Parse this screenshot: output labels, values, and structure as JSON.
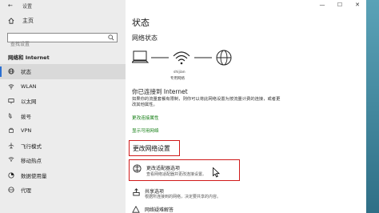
{
  "window": {
    "title": "设置",
    "controls": {
      "minimize": "—",
      "maximize": "☐",
      "close": "✕"
    }
  },
  "sidebar": {
    "back": "←",
    "home": "主页",
    "search_placeholder": "查找设置",
    "section": "网络和 Internet",
    "items": [
      {
        "label": "状态",
        "icon": "globe-icon"
      },
      {
        "label": "WLAN",
        "icon": "wifi-icon"
      },
      {
        "label": "以太网",
        "icon": "ethernet-icon"
      },
      {
        "label": "拨号",
        "icon": "dialup-icon"
      },
      {
        "label": "VPN",
        "icon": "vpn-icon"
      },
      {
        "label": "飞行模式",
        "icon": "airplane-icon"
      },
      {
        "label": "移动热点",
        "icon": "hotspot-icon"
      },
      {
        "label": "数据使用量",
        "icon": "data-usage-icon"
      },
      {
        "label": "代理",
        "icon": "globe-icon"
      }
    ]
  },
  "main": {
    "title": "状态",
    "network_status": "网络状态",
    "diagram": {
      "network_name": "shijian",
      "network_type": "专用网络"
    },
    "connected_heading": "你已连接到 Internet",
    "connected_desc": "如果你的流量套餐有限制，则你可以将此网络设置为按流量计费的连接，或者更改其他属性。",
    "change_properties": "更改连接属性",
    "show_networks": "显示可用网络",
    "change_settings": "更改网络设置",
    "adapter": {
      "title": "更改适配器选项",
      "desc": "查看网络适配器并更改连接设置。"
    },
    "sharing": {
      "title": "共享选项",
      "desc": "根据所连接到的网络，决定要共享的内容。"
    },
    "troubleshoot": {
      "title": "网络疑难解答"
    }
  },
  "colors": {
    "accent": "#2a6fd1",
    "link": "#107c10",
    "highlight_box": "#d01a1a",
    "desktop": "#3f7c94"
  }
}
